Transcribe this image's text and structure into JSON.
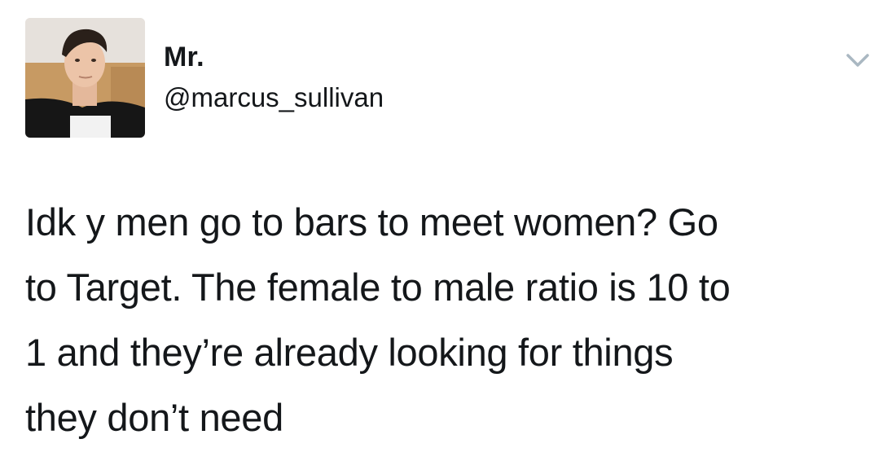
{
  "tweet": {
    "author": {
      "display_name": "Mr.",
      "handle": "@marcus_sullivan",
      "avatar_icon": "profile-photo"
    },
    "menu_icon": "chevron-down-icon",
    "text_lines": [
      "Idk y men go to bars to meet women? Go",
      "to Target. The female to male ratio is 10 to",
      "1 and they’re already looking for things",
      "they don’t need"
    ]
  },
  "colors": {
    "text": "#14171a",
    "caret": "#aab8c2",
    "background": "#ffffff"
  }
}
